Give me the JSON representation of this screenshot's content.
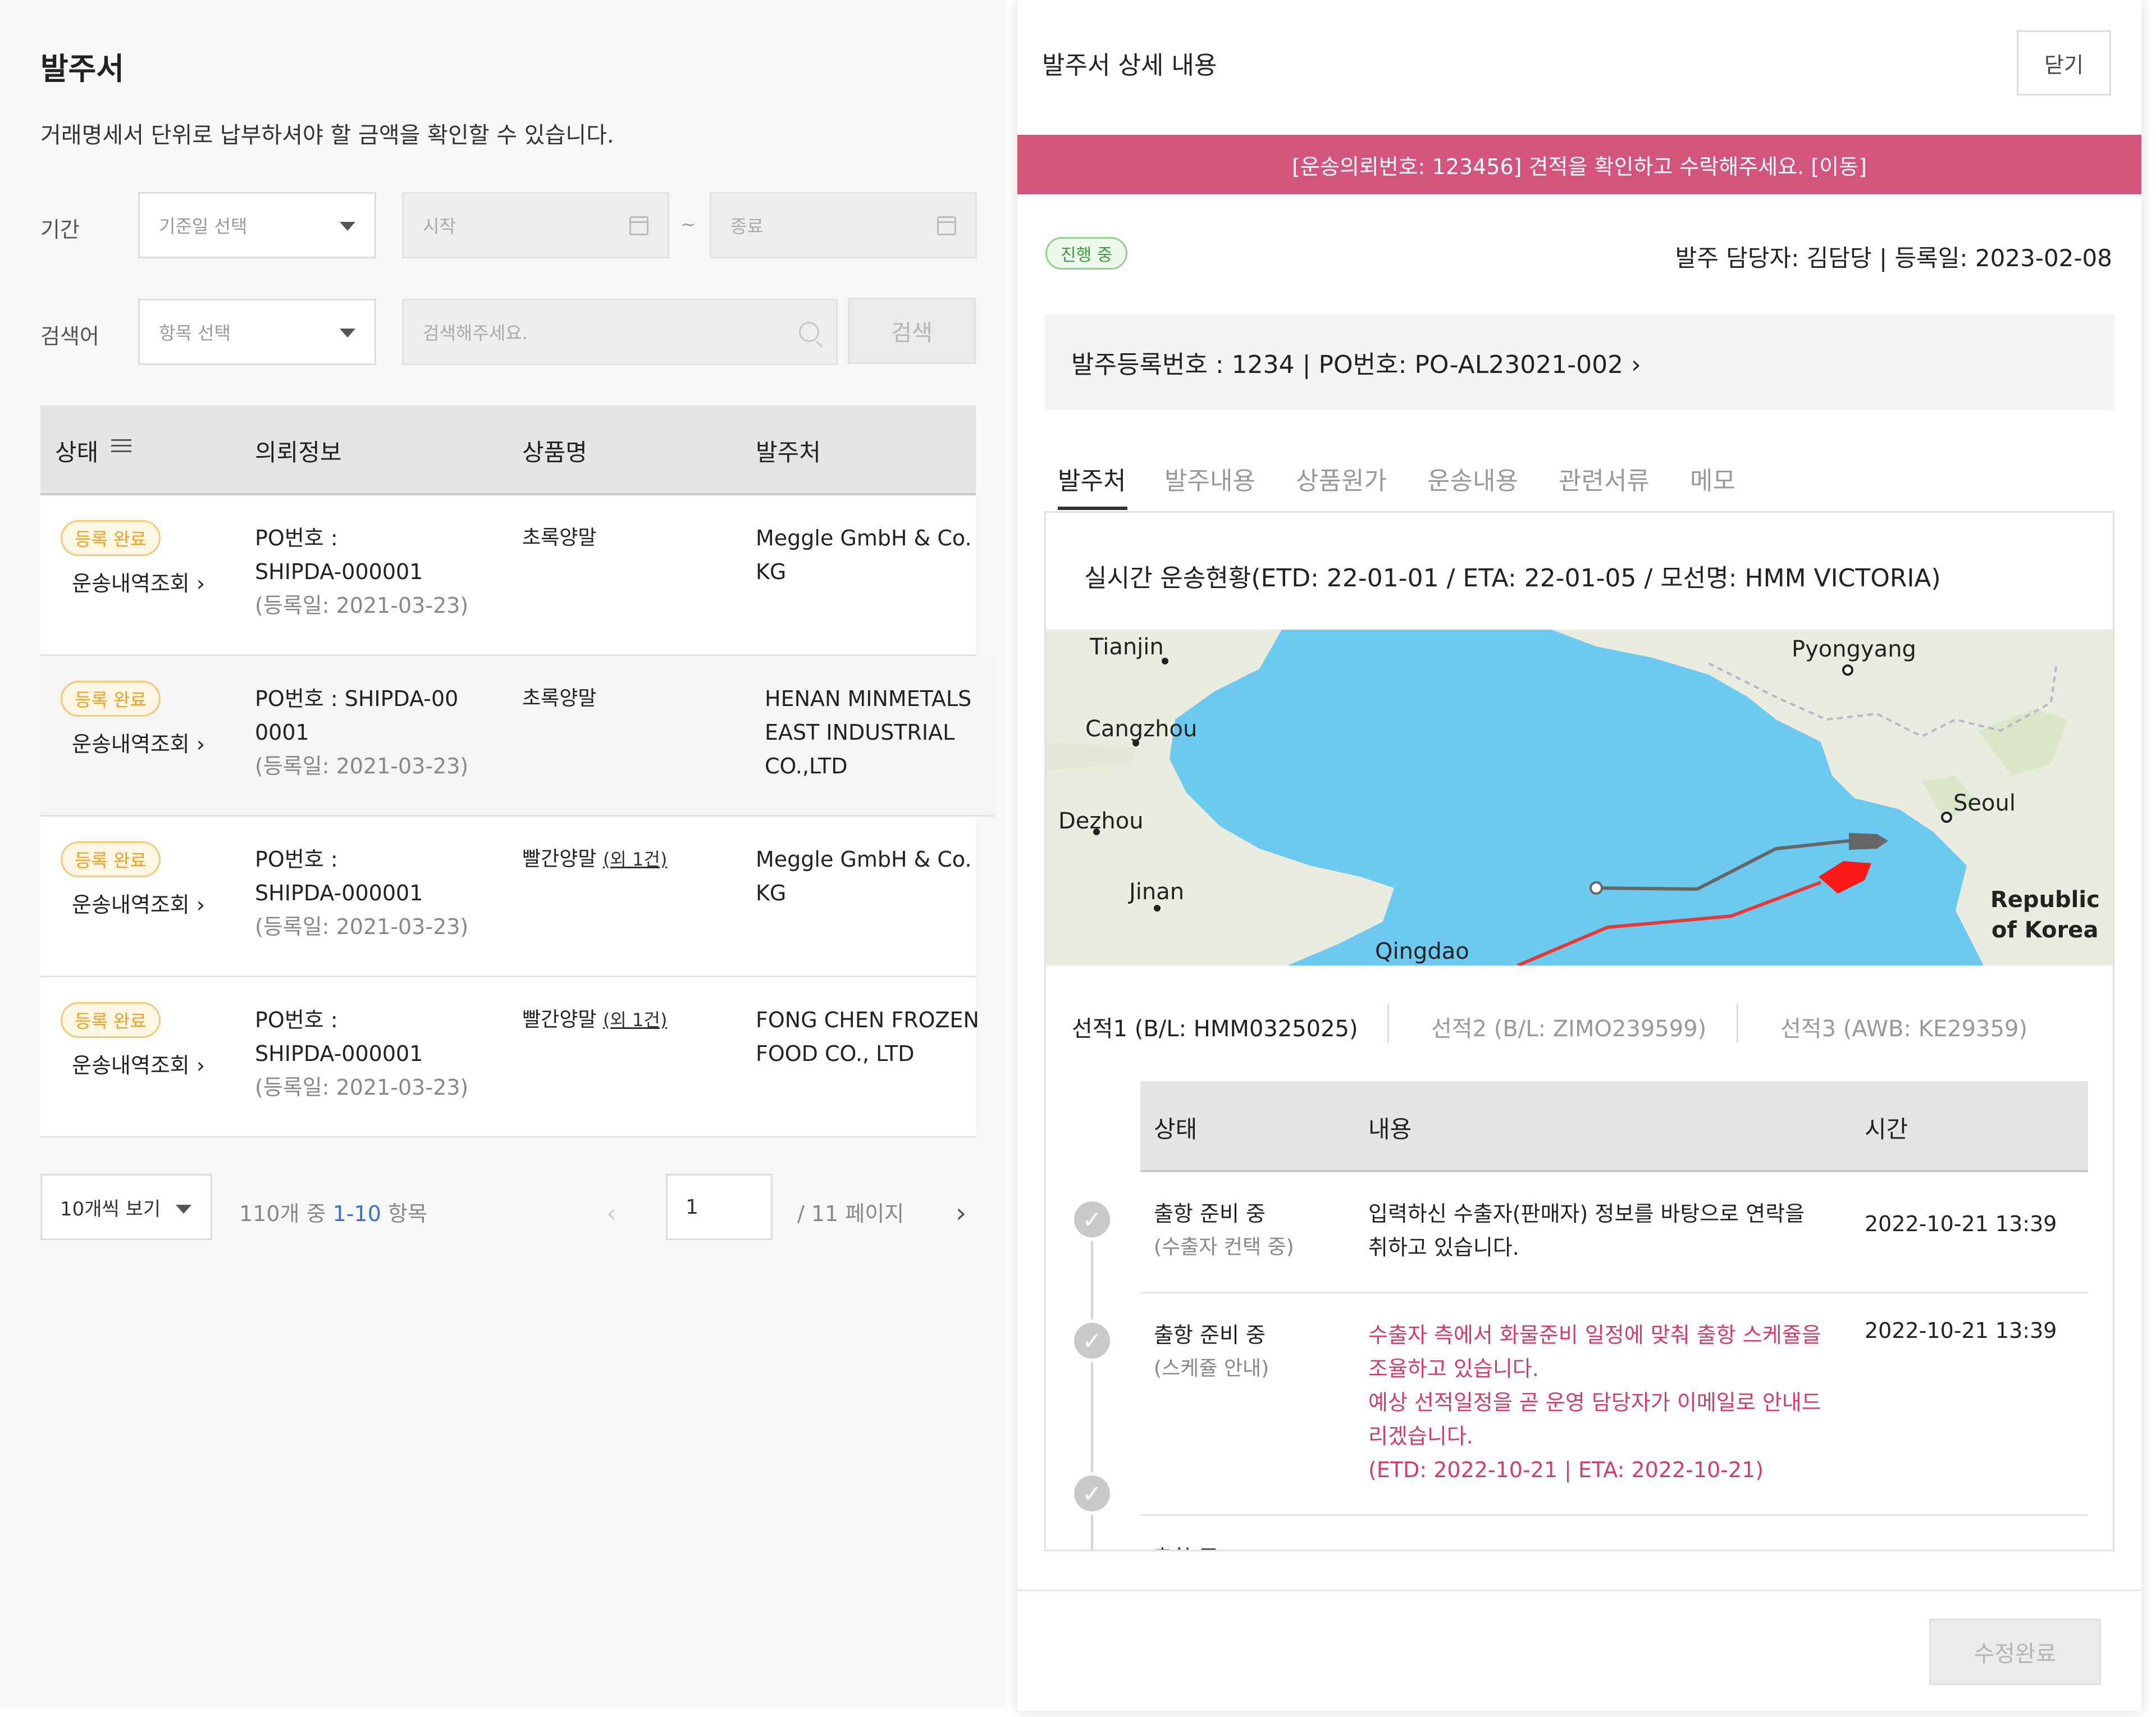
{
  "list": {
    "title": "발주서",
    "description": "거래명세서 단위로 납부하셔야 할 금액을 확인할 수 있습니다.",
    "filters": {
      "period_label": "기간",
      "period_select": "기준일 선택",
      "start_placeholder": "시작",
      "end_placeholder": "종료",
      "tilde": "~",
      "keyword_label": "검색어",
      "item_select": "항목 선택",
      "search_placeholder": "검색해주세요.",
      "search_button": "검색"
    },
    "columns": [
      "상태",
      "의뢰정보",
      "상품명",
      "발주처"
    ],
    "rows": [
      {
        "badge": "등록 완료",
        "tracking": "운송내역조회",
        "po_line1": "PO번호 :",
        "po_line2": "SHIPDA-000001",
        "date": "(등록일: 2021-03-23)",
        "product": "초록양말",
        "product_more": "",
        "vendor": "Meggle GmbH & Co. KG"
      },
      {
        "badge": "등록 완료",
        "tracking": "운송내역조회",
        "po_line1": "PO번호 : SHIPDA-00",
        "po_line2": "0001",
        "date": "(등록일: 2021-03-23)",
        "product": "초록양말",
        "product_more": "",
        "vendor": "HENAN MINMETALS EAST INDUSTRIAL CO.,LTD"
      },
      {
        "badge": "등록 완료",
        "tracking": "운송내역조회",
        "po_line1": "PO번호 :",
        "po_line2": "SHIPDA-000001",
        "date": "(등록일: 2021-03-23)",
        "product": "빨간양말",
        "product_more": "(외 1건)",
        "vendor": "Meggle GmbH & Co. KG"
      },
      {
        "badge": "등록 완료",
        "tracking": "운송내역조회",
        "po_line1": "PO번호 :",
        "po_line2": "SHIPDA-000001",
        "date": "(등록일: 2021-03-23)",
        "product": "빨간양말",
        "product_more": "(외 1건)",
        "vendor": "FONG CHEN FROZEN FOOD CO., LTD"
      }
    ],
    "pagination": {
      "page_size": "10개씩 보기",
      "total_prefix": "110개 중",
      "range": "1-10",
      "total_suffix": "항목",
      "current_page": "1",
      "total_pages": "/  11 페이지"
    }
  },
  "detail": {
    "title": "발주서 상세 내용",
    "close_button": "닫기",
    "banner": "[운송의뢰번호: 123456] 견적을 확인하고 수락해주세요.   [이동]",
    "status": "진행 중",
    "meta": "발주 담당자: 김담당  |  등록일: 2023-02-08",
    "info": "발주등록번호 : 1234    |    PO번호: PO-AL23021-002 ›",
    "tabs": [
      "발주처",
      "발주내용",
      "상품원가",
      "운송내용",
      "관련서류",
      "메모"
    ],
    "realtime_title": "실시간 운송현황(ETD: 22-01-01 / ETA: 22-01-05 / 모선명: HMM VICTORIA)",
    "map_labels": {
      "tianjin": "Tianjin",
      "cangzhou": "Cangzhou",
      "dezhou": "Dezhou",
      "jinan": "Jinan",
      "qingdao": "Qingdao",
      "pyongyang": "Pyongyang",
      "seoul": "Seoul",
      "rok1": "Republic",
      "rok2": "of Korea"
    },
    "shipments": [
      "선적1 (B/L: HMM0325025)",
      "선적2 (B/L: ZIMO239599)",
      "선적3 (AWB: KE29359)"
    ],
    "timeline_columns": [
      "상태",
      "내용",
      "시간"
    ],
    "timeline": [
      {
        "status": "출항 준비 중",
        "sub": "(수출자 컨택 중)",
        "content": [
          "입력하신 수출자(판매자) 정보를 바탕으로 연락을",
          "취하고 있습니다."
        ],
        "time": "2022-10-21 13:39"
      },
      {
        "status": "출항 준비 중",
        "sub": "(스케쥴 안내)",
        "content": [
          "수출자 측에서 화물준비 일정에 맞춰 출항 스케쥴을",
          "조율하고 있습니다.",
          "예상 선적일정을 곧 운영 담당자가 이메일로 안내드",
          "리겠습니다.",
          "(ETD: 2022-10-21 | ETA: 2022-10-21)"
        ],
        "time": "2022-10-21 13:39"
      }
    ],
    "timeline_cut": "출항 준",
    "save_button": "수정완료"
  },
  "colors": {
    "banner": "#d4557c",
    "badge_orange": "#f0a020",
    "status_green": "#3e9a3e",
    "sea": "#6ccaf0",
    "land": "#e9ecdf",
    "route_red": "#e53935",
    "link_blue": "#3b6fd8"
  },
  "icons": [
    "sort-icon",
    "chevron-right-icon",
    "caret-down-icon",
    "calendar-icon",
    "search-icon",
    "check-icon",
    "ship-icon"
  ]
}
